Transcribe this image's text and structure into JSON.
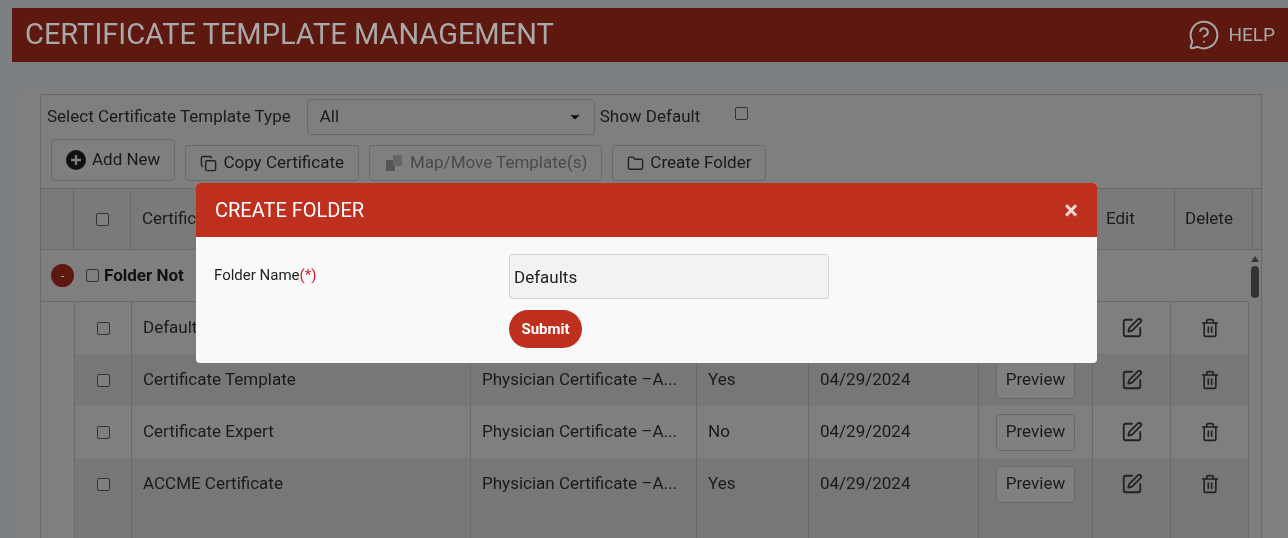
{
  "header": {
    "title": "CERTIFICATE TEMPLATE MANAGEMENT",
    "help_label": "HELP"
  },
  "filters": {
    "type_label": "Select Certificate Template Type",
    "type_value": "All",
    "show_default_label": "Show Default",
    "show_default_checked": false
  },
  "toolbar": [
    {
      "kind": "add",
      "label": "Add New",
      "disabled": false
    },
    {
      "kind": "copy",
      "label": "Copy Certificate",
      "disabled": false
    },
    {
      "kind": "map",
      "label": "Map/Move Template(s)",
      "disabled": true
    },
    {
      "kind": "folder",
      "label": "Create Folder",
      "disabled": false
    }
  ],
  "table": {
    "select_all_checked": false,
    "name_header": "Certific",
    "edit_header": "Edit",
    "delete_header": "Delete",
    "folder": {
      "toggle": "-",
      "expanded": true,
      "checked": false,
      "name": "Folder Not"
    },
    "rows": [
      {
        "checked": false,
        "name": "Default"
      },
      {
        "checked": false,
        "name": "Certificate Template",
        "type": "Physician Certificate –A...",
        "default": "Yes",
        "date": "04/29/2024",
        "preview": "Preview"
      },
      {
        "checked": false,
        "name": "Certificate Expert",
        "type": "Physician Certificate –A...",
        "default": "No",
        "date": "04/29/2024",
        "preview": "Preview"
      },
      {
        "checked": false,
        "name": "ACCME Certificate",
        "type": "Physician Certificate –A...",
        "default": "Yes",
        "date": "04/29/2024",
        "preview": "Preview"
      }
    ]
  },
  "modal": {
    "title": "CREATE FOLDER",
    "close": "×",
    "field_label": "Folder Name",
    "required_mark": "(*)",
    "value": "Defaults",
    "submit": "Submit"
  }
}
